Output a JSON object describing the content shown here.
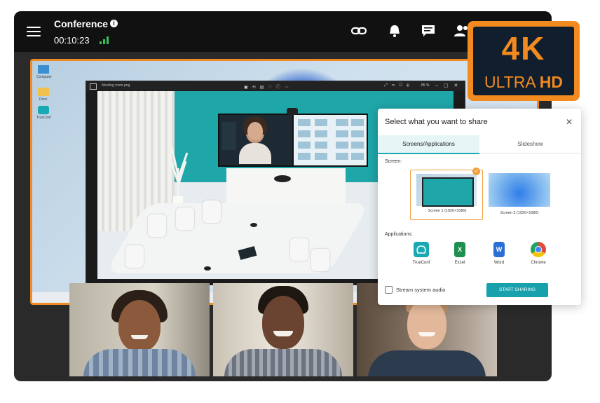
{
  "header": {
    "title": "Conference",
    "timer": "00:10:23",
    "icons": [
      "menu-icon",
      "info-icon",
      "signal-icon",
      "link-icon",
      "bell-icon",
      "chat-icon",
      "participants-icon"
    ]
  },
  "desktop": {
    "icons": [
      {
        "label": "Computer"
      },
      {
        "label": "Docs"
      },
      {
        "label": "TrueConf"
      }
    ],
    "viewer_title": "Meeting room.png",
    "zoom": "85 %"
  },
  "share_dialog": {
    "title": "Select what you want to share",
    "tabs": [
      {
        "label": "Screens/Applications",
        "active": true
      },
      {
        "label": "Slideshow",
        "active": false
      }
    ],
    "screen_label": "Screen:",
    "screens": [
      {
        "caption": "Screen 1 (1920×1080)",
        "selected": true
      },
      {
        "caption": "Screen 2 (1920×1080)",
        "selected": false
      }
    ],
    "applications_label": "Applications:",
    "applications": [
      {
        "name": "TrueConf",
        "color": "#1aa9b3"
      },
      {
        "name": "Excel",
        "color": "#1d8f4e"
      },
      {
        "name": "Word",
        "color": "#2b6fd6"
      },
      {
        "name": "Chrome",
        "color": "#e24a3b"
      }
    ],
    "stream_audio_label": "Stream system audio",
    "start_button": "START SHARING"
  },
  "badge": {
    "line1": "4K",
    "line2a": "ULTRA",
    "line2b": "HD"
  },
  "colors": {
    "accent": "#f08a24",
    "teal": "#17a1ac",
    "topbar": "#111111"
  }
}
